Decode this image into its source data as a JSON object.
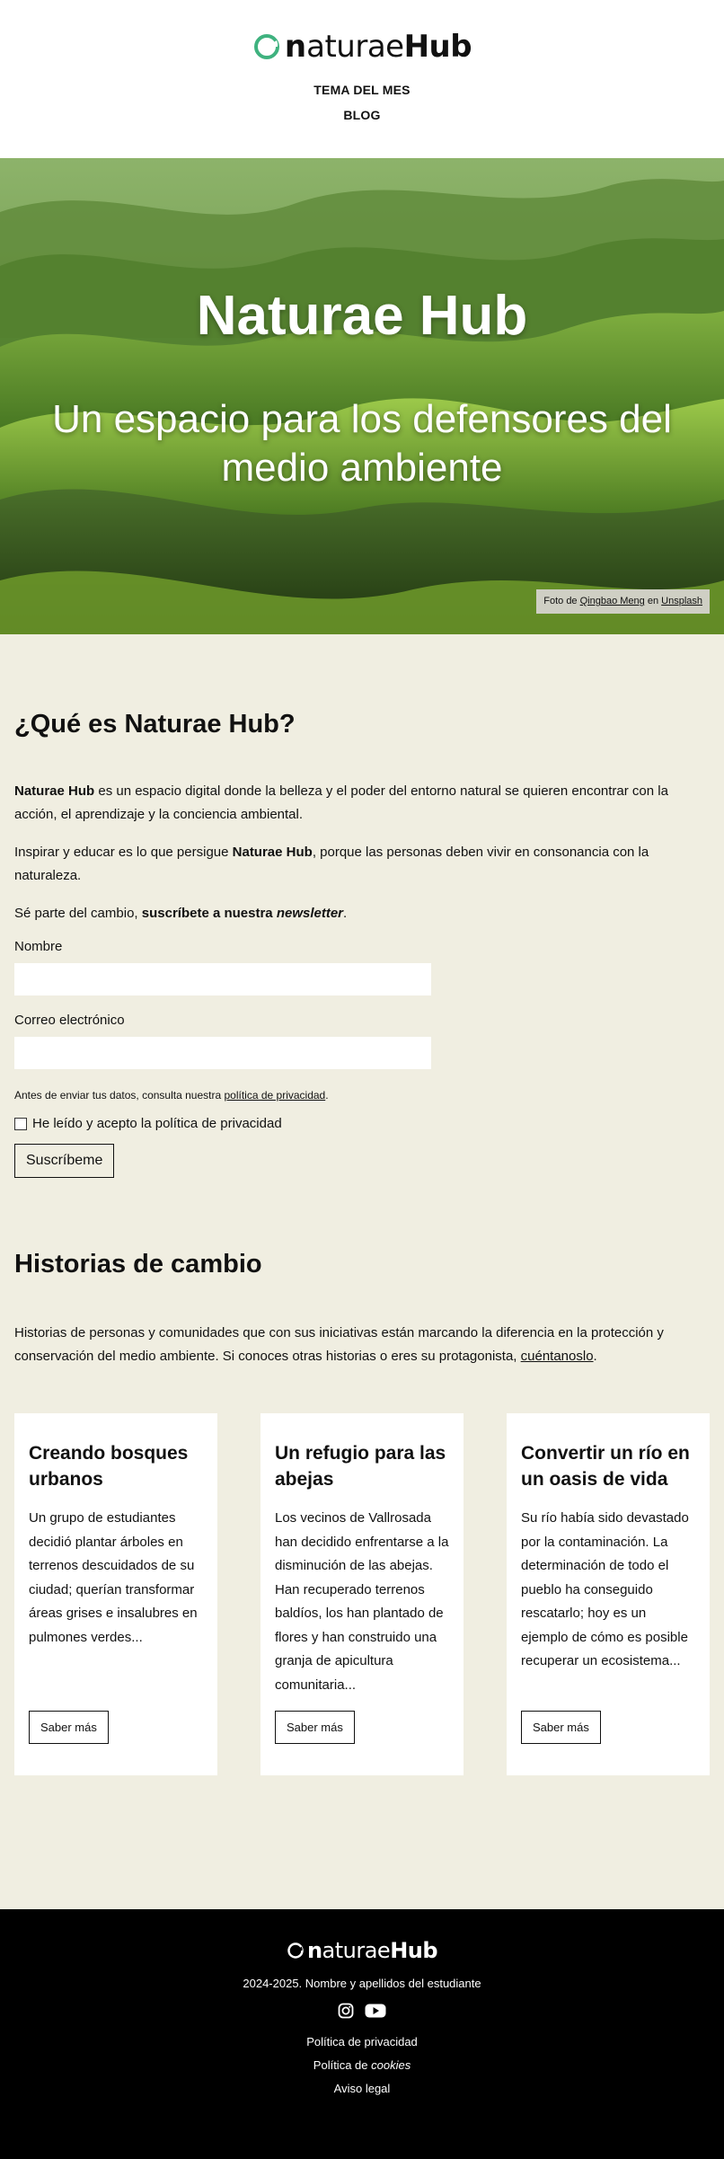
{
  "header": {
    "logo": {
      "prefix": "n",
      "light": "aturae",
      "bold": "Hub"
    },
    "nav": [
      "TEMA DEL MES",
      "BLOG"
    ]
  },
  "hero": {
    "title": "Naturae Hub",
    "subtitle": "Un espacio para los defensores del medio ambiente",
    "credit": {
      "pre": "Foto de ",
      "author": "Qingbao Meng",
      "mid": " en ",
      "source": "Unsplash"
    }
  },
  "about": {
    "heading": "¿Qué es Naturae Hub?",
    "p1_bold": "Naturae Hub",
    "p1_rest": " es un espacio digital donde la belleza y el poder del entorno natural se quieren encontrar con la acción, el aprendizaje y la conciencia ambiental.",
    "p2_pre": "Inspirar y educar es lo que persigue ",
    "p2_bold": "Naturae Hub",
    "p2_post": ", porque las personas deben vivir en consonancia con la naturaleza.",
    "p3_pre": "Sé parte del cambio, ",
    "p3_bold": "suscríbete a nuestra ",
    "p3_italic": "newsletter",
    "p3_post": ".",
    "form": {
      "name_label": "Nombre",
      "name_value": "",
      "email_label": "Correo electrónico",
      "email_value": "",
      "privacy_pre": "Antes de enviar tus datos, consulta nuestra ",
      "privacy_link": "política de privacidad",
      "privacy_post": ".",
      "checkbox_label": "He leído y acepto la política de privacidad",
      "submit_label": "Suscríbeme"
    }
  },
  "stories": {
    "heading": "Historias de cambio",
    "intro_pre": "Historias de personas y comunidades que con sus iniciativas están marcando la diferencia en la protección y conservación del medio ambiente. Si conoces otras historias o eres su protagonista, ",
    "intro_link": "cuéntanoslo",
    "intro_post": ".",
    "cards": [
      {
        "title": "Creando bosques urbanos",
        "text": "Un grupo de estudiantes decidió plantar árboles en terrenos descuidados de su ciudad; querían transformar áreas grises e insalubres en pulmones verdes...",
        "button": "Saber más"
      },
      {
        "title": "Un refugio para las abejas",
        "text": "Los vecinos de Vallrosada han decidido enfrentarse a la disminución de las abejas. Han recuperado terrenos baldíos, los han plantado de flores y han construido una granja de apicultura comunitaria...",
        "button": "Saber más"
      },
      {
        "title": "Convertir un río en un oasis de vida",
        "text": "Su río había sido devastado por la contaminación. La determinación de todo el pueblo ha conseguido rescatarlo; hoy es un ejemplo de cómo es posible recuperar un ecosistema...",
        "button": "Saber más"
      }
    ]
  },
  "footer": {
    "logo": {
      "prefix": "n",
      "light": "aturae",
      "bold": "Hub"
    },
    "credit": "2024-2025. Nombre y apellidos del estudiante",
    "social": [
      "instagram-icon",
      "youtube-icon"
    ],
    "links": [
      {
        "pre": "Política de privacidad",
        "italic": ""
      },
      {
        "pre": "Política de ",
        "italic": "cookies"
      },
      {
        "pre": "Aviso legal",
        "italic": ""
      }
    ]
  },
  "colors": {
    "page_bg": "#f0eee1",
    "logo_accent": "#3fb27f",
    "footer_bg": "#000000"
  }
}
